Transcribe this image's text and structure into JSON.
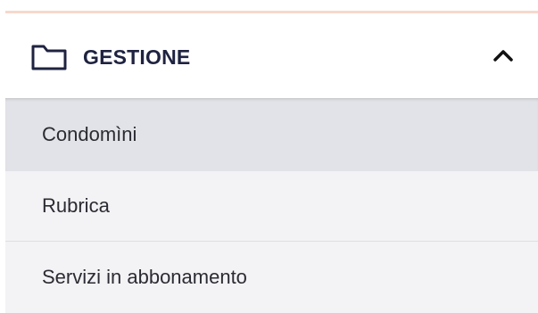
{
  "section": {
    "title": "GESTIONE",
    "icon": "folder-icon",
    "toggle_icon": "chevron-up-icon",
    "expanded": true
  },
  "menu": {
    "items": [
      {
        "label": "Condomìni",
        "selected": true
      },
      {
        "label": "Rubrica",
        "selected": false
      },
      {
        "label": "Servizi in abbonamento",
        "selected": false
      }
    ]
  },
  "colors": {
    "accent_line": "#f6d9cb",
    "title_text": "#1f2340",
    "selected_bg": "#e2e3e8",
    "item_bg": "#f3f3f5"
  }
}
